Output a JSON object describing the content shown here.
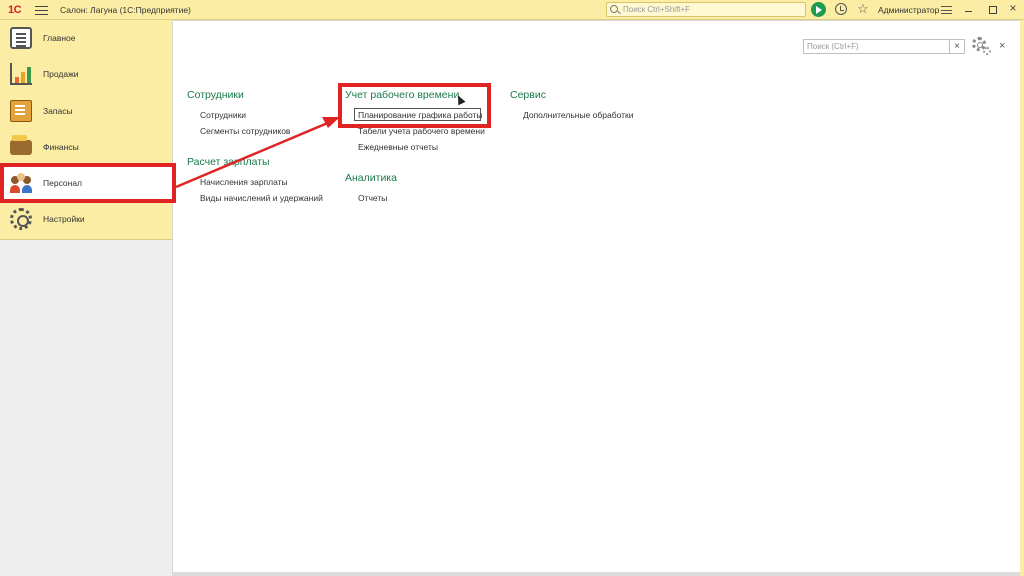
{
  "titlebar": {
    "logo": "1С",
    "app_title": "Салон: Лагуна  (1С:Предприятие)",
    "search_placeholder": "Поиск Ctrl+Shift+F",
    "user_name": "Администратор",
    "close_glyph": "×",
    "star_glyph": "☆"
  },
  "sidebar": {
    "items": [
      {
        "label": "Главное",
        "icon": "main-icon"
      },
      {
        "label": "Продажи",
        "icon": "sales-icon"
      },
      {
        "label": "Запасы",
        "icon": "stock-icon"
      },
      {
        "label": "Финансы",
        "icon": "finance-icon"
      },
      {
        "label": "Персонал",
        "icon": "personnel-icon",
        "active": true
      },
      {
        "label": "Настройки",
        "icon": "settings-icon"
      }
    ]
  },
  "main": {
    "search_placeholder": "Поиск (Ctrl+F)",
    "search_clear": "×",
    "close_glyph": "×",
    "groups": {
      "employees": {
        "title": "Сотрудники",
        "links": [
          "Сотрудники",
          "Сегменты сотрудников"
        ]
      },
      "payroll": {
        "title": "Расчет зарплаты",
        "links": [
          "Начисления зарплаты",
          "Виды начислений и удержаний"
        ]
      },
      "time_tracking": {
        "title": "Учет рабочего времени",
        "links": [
          "Планирование графика работы",
          "Табели учета рабочего времени",
          "Ежедневные отчеты"
        ]
      },
      "analytics": {
        "title": "Аналитика",
        "links": [
          "Отчеты"
        ]
      },
      "service": {
        "title": "Сервис",
        "links": [
          "Дополнительные обработки"
        ]
      }
    }
  },
  "colors": {
    "panel_bg": "#fbeda4",
    "group_title": "#1b7a4c",
    "highlight_red": "#e02424",
    "play_green": "#1e9b4c"
  }
}
